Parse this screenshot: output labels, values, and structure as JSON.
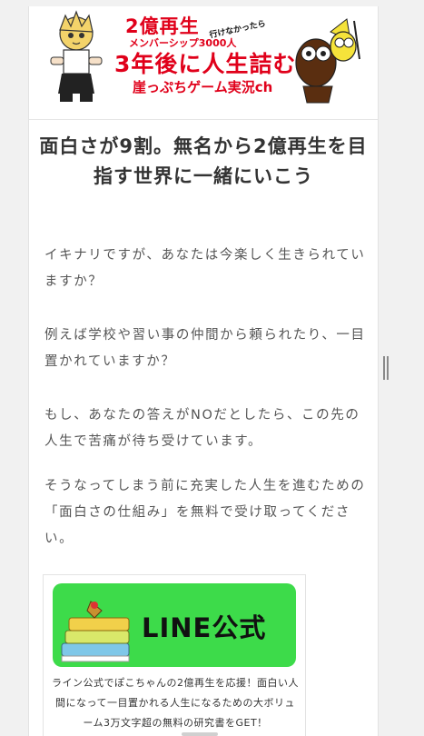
{
  "banner": {
    "line1": "2億再生",
    "small": "行けなかったら",
    "line2": "メンバーシップ3000人",
    "line3": "3年後に人生詰む",
    "line4": "崖っぷちゲーム実況ch"
  },
  "headline": "面白さが9割。無名から2億再生を目指す世界に一緒にいこう",
  "paragraphs": [
    "イキナリですが、あなたは今楽しく生きられていますか？",
    "例えば学校や習い事の仲間から頼られたり、一目置かれていますか？",
    "もし、あなたの答えがNOだとしたら、この先の人生で苦痛が待ち受けています。",
    "そうなってしまう前に充実した人生を進むための「面白さの仕組み」を無料で受け取ってください。"
  ],
  "line_box": {
    "button_label": "LINE公式",
    "description": "ライン公式でぽこちゃんの2億再生を応援！面白い人間になって一目置かれる人生になるための大ボリューム3万文字超の無料の研究書をGET！"
  },
  "colors": {
    "accent_red": "#e0001a",
    "line_green": "#3ddb4a"
  }
}
